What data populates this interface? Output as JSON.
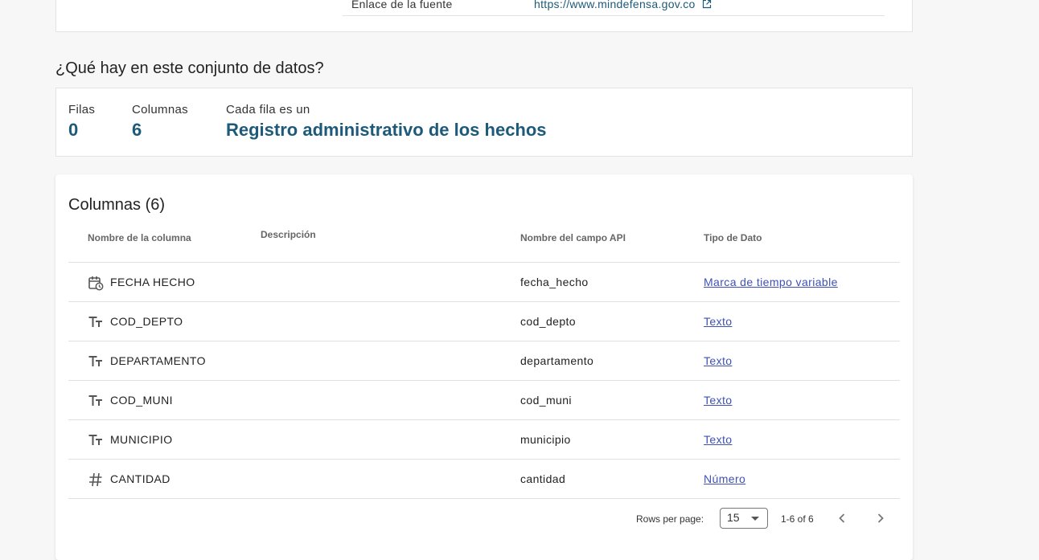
{
  "source": {
    "label": "Enlace de la fuente",
    "link": "https://www.mindefensa.gov.co"
  },
  "dataset_section": {
    "title": "¿Qué hay en este conjunto de datos?",
    "rows_label": "Filas",
    "rows_value": "0",
    "columns_label": "Columnas",
    "columns_value": "6",
    "each_row_label": "Cada fila es un",
    "each_row_value": "Registro administrativo de los hechos"
  },
  "columns_table": {
    "title": "Columnas (6)",
    "headers": {
      "name": "Nombre de la columna",
      "description": "Descripción",
      "api_field": "Nombre del campo API",
      "data_type": "Tipo de Dato"
    },
    "rows": [
      {
        "icon": "calendar-clock-icon",
        "name": "FECHA HECHO",
        "description": "",
        "api_field": "fecha_hecho",
        "data_type": "Marca de tiempo variable"
      },
      {
        "icon": "text-type-icon",
        "name": "COD_DEPTO",
        "description": "",
        "api_field": "cod_depto",
        "data_type": "Texto"
      },
      {
        "icon": "text-type-icon",
        "name": "DEPARTAMENTO",
        "description": "",
        "api_field": "departamento",
        "data_type": "Texto"
      },
      {
        "icon": "text-type-icon",
        "name": "COD_MUNI",
        "description": "",
        "api_field": "cod_muni",
        "data_type": "Texto"
      },
      {
        "icon": "text-type-icon",
        "name": "MUNICIPIO",
        "description": "",
        "api_field": "municipio",
        "data_type": "Texto"
      },
      {
        "icon": "number-type-icon",
        "name": "CANTIDAD",
        "description": "",
        "api_field": "cantidad",
        "data_type": "Número"
      }
    ]
  },
  "pagination": {
    "rows_per_page_label": "Rows per page:",
    "rows_per_page_value": "15",
    "range_text": "1-6 of 6"
  },
  "colors": {
    "accent": "#1d5a7a",
    "link": "#3f51b5"
  }
}
